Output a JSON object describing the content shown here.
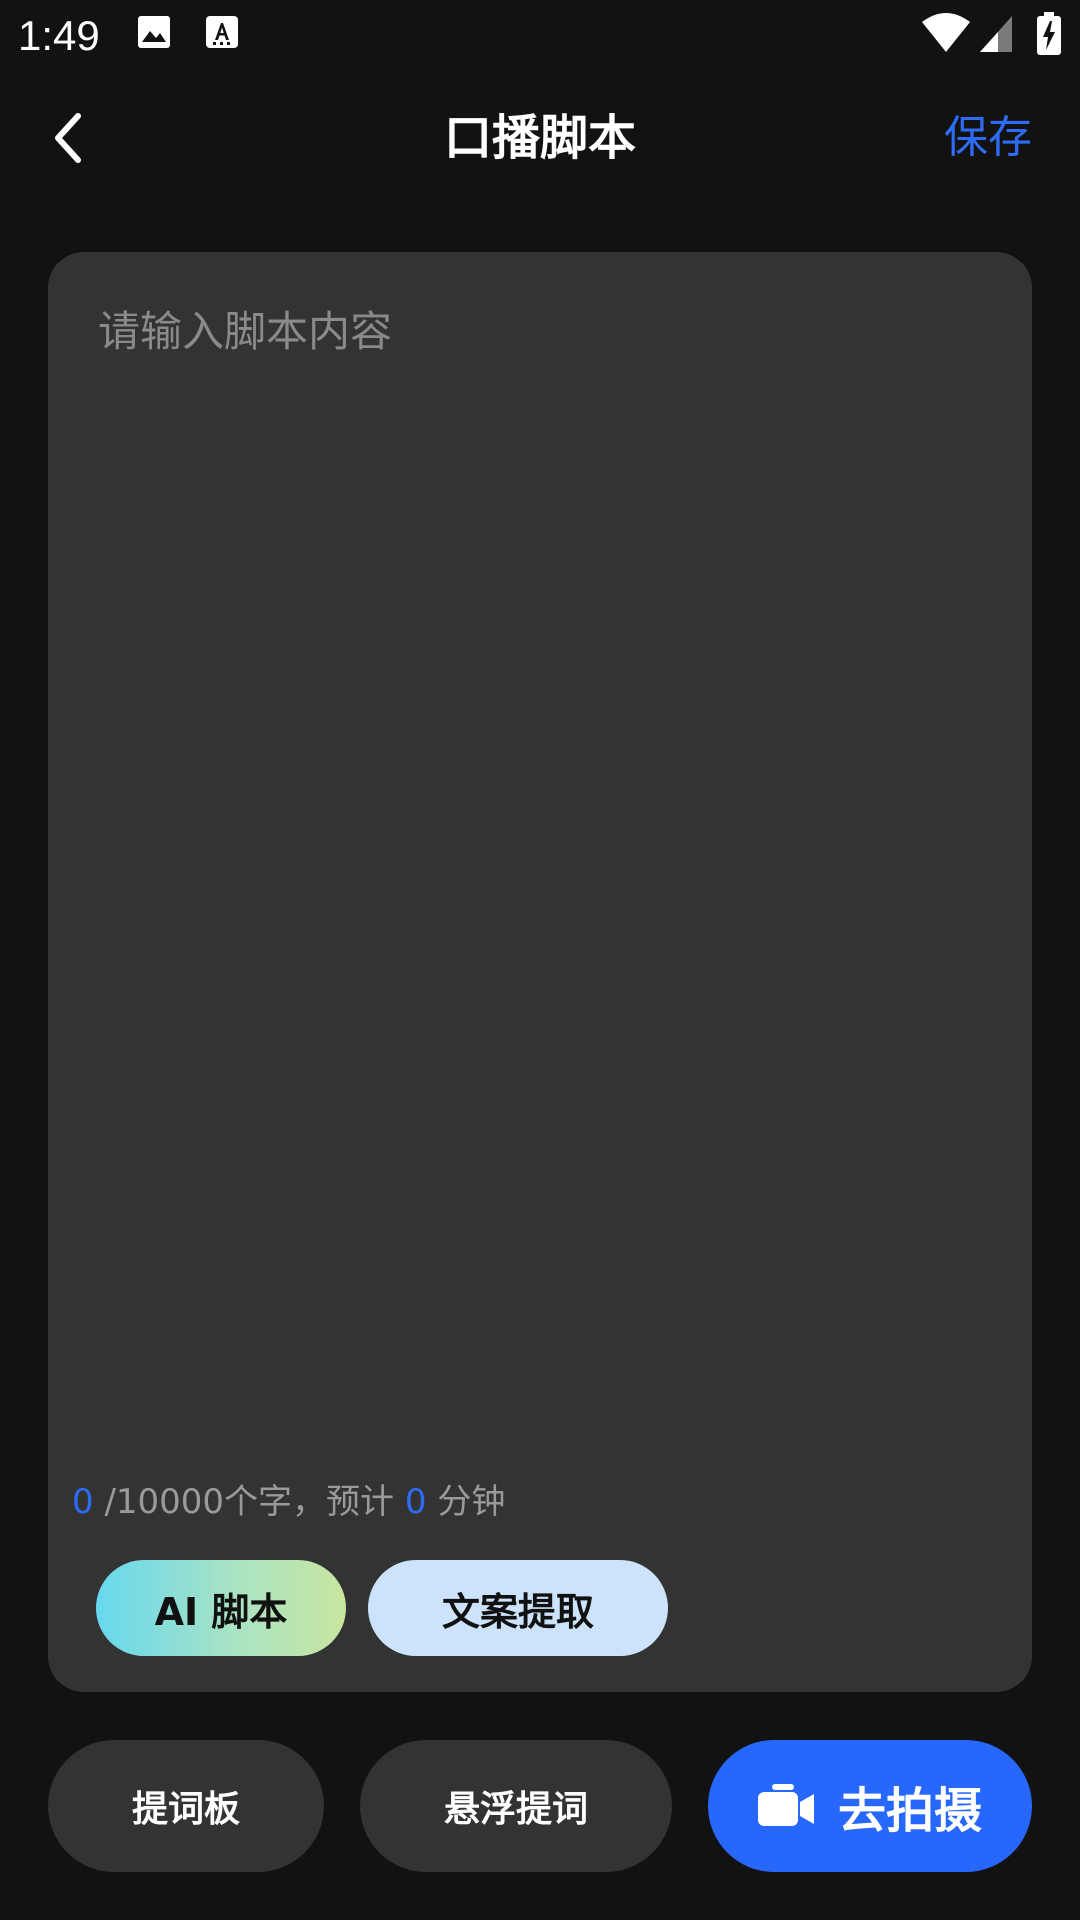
{
  "status_bar": {
    "time": "1:49",
    "icons": [
      "image-icon",
      "text-recognition-icon",
      "wifi-icon",
      "cellular-signal-icon",
      "battery-charging-icon"
    ]
  },
  "header": {
    "title": "口播脚本",
    "save_label": "保存",
    "back_icon": "chevron-left-icon"
  },
  "editor": {
    "placeholder": "请输入脚本内容",
    "value": "",
    "char_count": "0",
    "char_limit_text": " /10000个字，预计 ",
    "minutes": "0",
    "minutes_unit": " 分钟",
    "chips": {
      "ai_script": "AI 脚本",
      "copy_extract": "文案提取"
    }
  },
  "bottom_bar": {
    "teleprompter": "提词板",
    "floating_prompt": "悬浮提词",
    "go_shoot": "去拍摄",
    "go_shoot_icon": "video-camera-icon"
  },
  "colors": {
    "background": "#121212",
    "card": "#333333",
    "accent": "#2f6cf6",
    "primary_button": "#2767fb",
    "chip_extract": "#cce3fb"
  }
}
